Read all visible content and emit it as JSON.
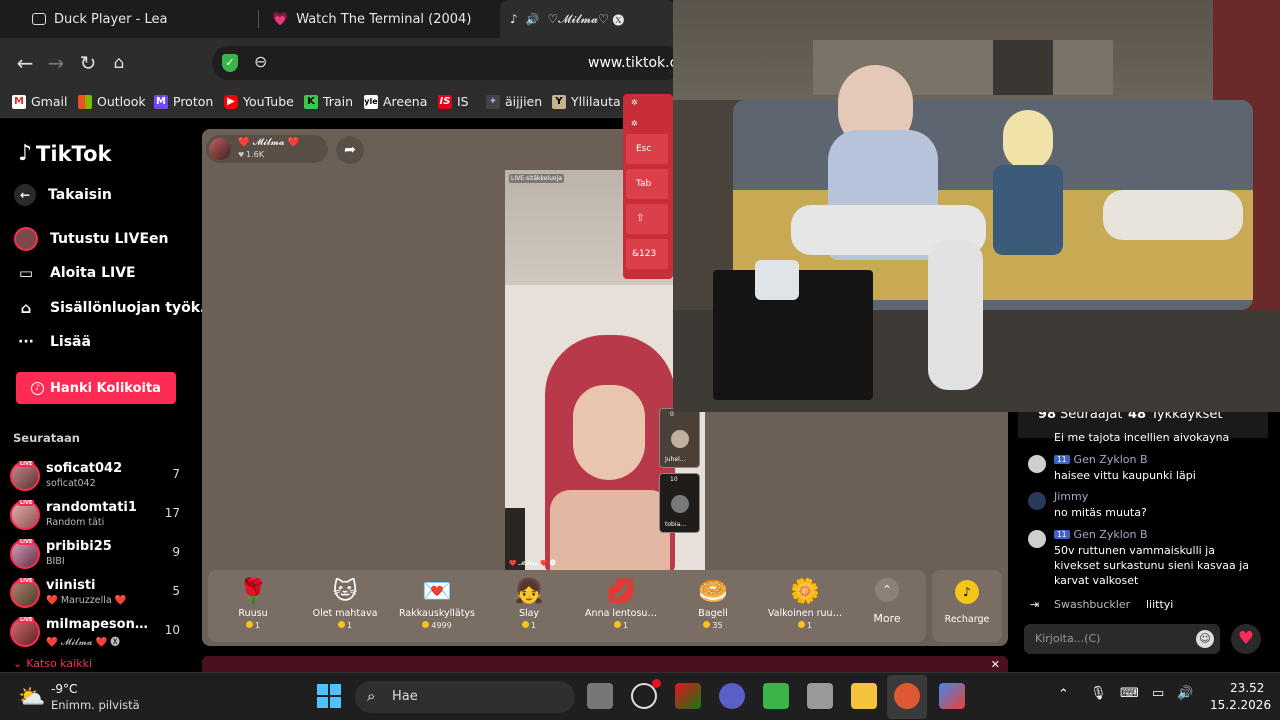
{
  "browser": {
    "tabs": [
      {
        "title": "Duck Player - Lea"
      },
      {
        "title": "Watch The Terminal (2004)"
      },
      {
        "title": "♡𝓜𝓲𝓵𝓶𝓪♡ 🅧"
      }
    ],
    "url": "www.tiktok.co",
    "bookmarks": [
      "Gmail",
      "Outlook",
      "Proton",
      "YouTube",
      "Train",
      "Areena",
      "IS",
      "äijjien",
      "Yllilauta"
    ]
  },
  "sidebar": {
    "logo": "TikTok",
    "back": "Takaisin",
    "nav": [
      "Tutustu LIVEen",
      "Aloita LIVE",
      "Sisällönluojan työk…",
      "Lisää"
    ],
    "coins_button": "Hanki Kolikoita",
    "following_heading": "Seurataan",
    "following": [
      {
        "name": "soficat042",
        "sub": "soficat042",
        "count": "7"
      },
      {
        "name": "randomtati1",
        "sub": "Random täti",
        "count": "17"
      },
      {
        "name": "pribibi25",
        "sub": "BIBI",
        "count": "9"
      },
      {
        "name": "viinisti",
        "sub": "❤️ Maruzzella ❤️",
        "count": "5"
      },
      {
        "name": "milmapeson…",
        "sub": "❤️ 𝓜𝓲𝓵𝓶𝓪 ❤️ 🅧",
        "count": "10"
      }
    ],
    "see_all": "Katso kaikki"
  },
  "live": {
    "host_name": "❤️ 𝓜𝓲𝓵𝓶𝓪 ❤️",
    "host_likes": "1.6K",
    "video_tag": "LIVE-sitäkkeluoja",
    "video_caption": "❤️ 𝓜𝓲𝓵𝓶𝓪 ❤️ 🅧",
    "guest1": "Juhel…",
    "guest2": "tobia…",
    "guest1_count": "0",
    "guest2_count": "10"
  },
  "keyboard": {
    "keys": [
      "Esc",
      "Tab",
      "⇧",
      "&123"
    ]
  },
  "gifts": [
    {
      "icon": "🌹",
      "name": "Ruusu",
      "price": "1"
    },
    {
      "icon": "🐱",
      "name": "Olet mahtava",
      "price": "1"
    },
    {
      "icon": "💌",
      "name": "Rakkauskyllätys",
      "price": "4999"
    },
    {
      "icon": "👧",
      "name": "Slay",
      "price": "1"
    },
    {
      "icon": "💋",
      "name": "Anna lentosu…",
      "price": "1"
    },
    {
      "icon": "🥯",
      "name": "Bagell",
      "price": "35"
    },
    {
      "icon": "🌼",
      "name": "Valkoinen ruu…",
      "price": "1"
    }
  ],
  "gifts_more": "More",
  "recharge": "Recharge",
  "stats": {
    "followers": "98",
    "followers_label": "Seuraajat",
    "likes": "48",
    "likes_label": "Tykkäykset"
  },
  "chat": {
    "partial": "Ei me tajota incellien aivokayna",
    "messages": [
      {
        "level": "11",
        "user": "Gen Zyklon B",
        "text": "haisee vittu kaupunki läpi"
      },
      {
        "level": "",
        "user": "Jimmy",
        "text": "no mitäs muuta?"
      },
      {
        "level": "11",
        "user": "Gen Zyklon B",
        "text": "50v ruttunen vammaiskulli ja kivekset surkastunu sieni kasvaa ja karvat valkoset"
      }
    ],
    "join_user": "Swashbuckler",
    "join_text": "liittyi",
    "input_placeholder": "Kirjoita...(C)"
  },
  "taskbar": {
    "temp": "-9°C",
    "weather": "Enimm. pilvistä",
    "search": "Hae",
    "time": "23.52",
    "date": "15.2.2026"
  }
}
